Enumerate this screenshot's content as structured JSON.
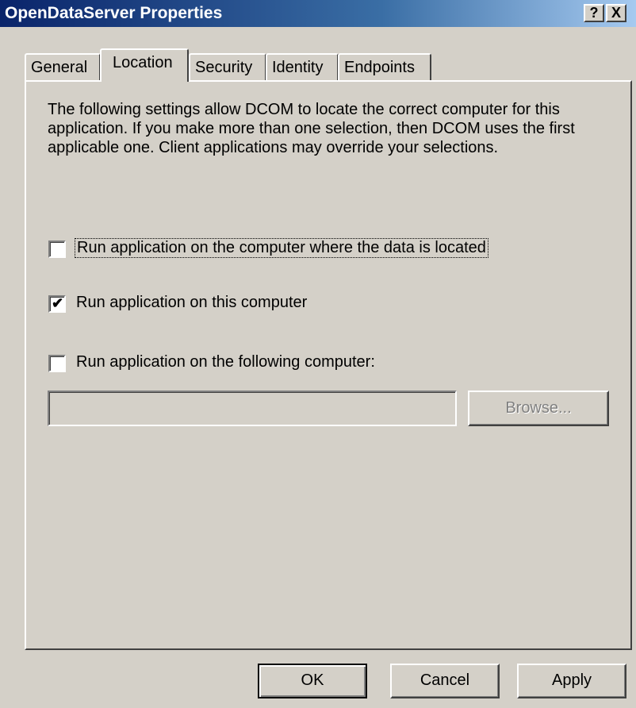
{
  "window": {
    "title": "OpenDataServer Properties",
    "help_glyph": "?",
    "close_glyph": "X"
  },
  "tabs": [
    {
      "label": "General",
      "active": false
    },
    {
      "label": "Location",
      "active": true
    },
    {
      "label": "Security",
      "active": false
    },
    {
      "label": "Identity",
      "active": false
    },
    {
      "label": "Endpoints",
      "active": false
    }
  ],
  "location": {
    "description": "The following settings allow DCOM to locate the correct computer for this application.  If you make more than one selection, then DCOM uses the first applicable one.  Client applications may override your selections.",
    "options": [
      {
        "label": "Run application on the computer where the data is located",
        "checked": false
      },
      {
        "label": "Run application on this computer",
        "checked": true
      },
      {
        "label": "Run application on the following computer:",
        "checked": false
      }
    ],
    "computer_value": "",
    "browse_label": "Browse..."
  },
  "footer": {
    "ok_label": "OK",
    "cancel_label": "Cancel",
    "apply_label": "Apply"
  },
  "colors": {
    "face": "#d4d0c8",
    "title_start": "#0a246a",
    "title_end": "#a6caf0"
  }
}
